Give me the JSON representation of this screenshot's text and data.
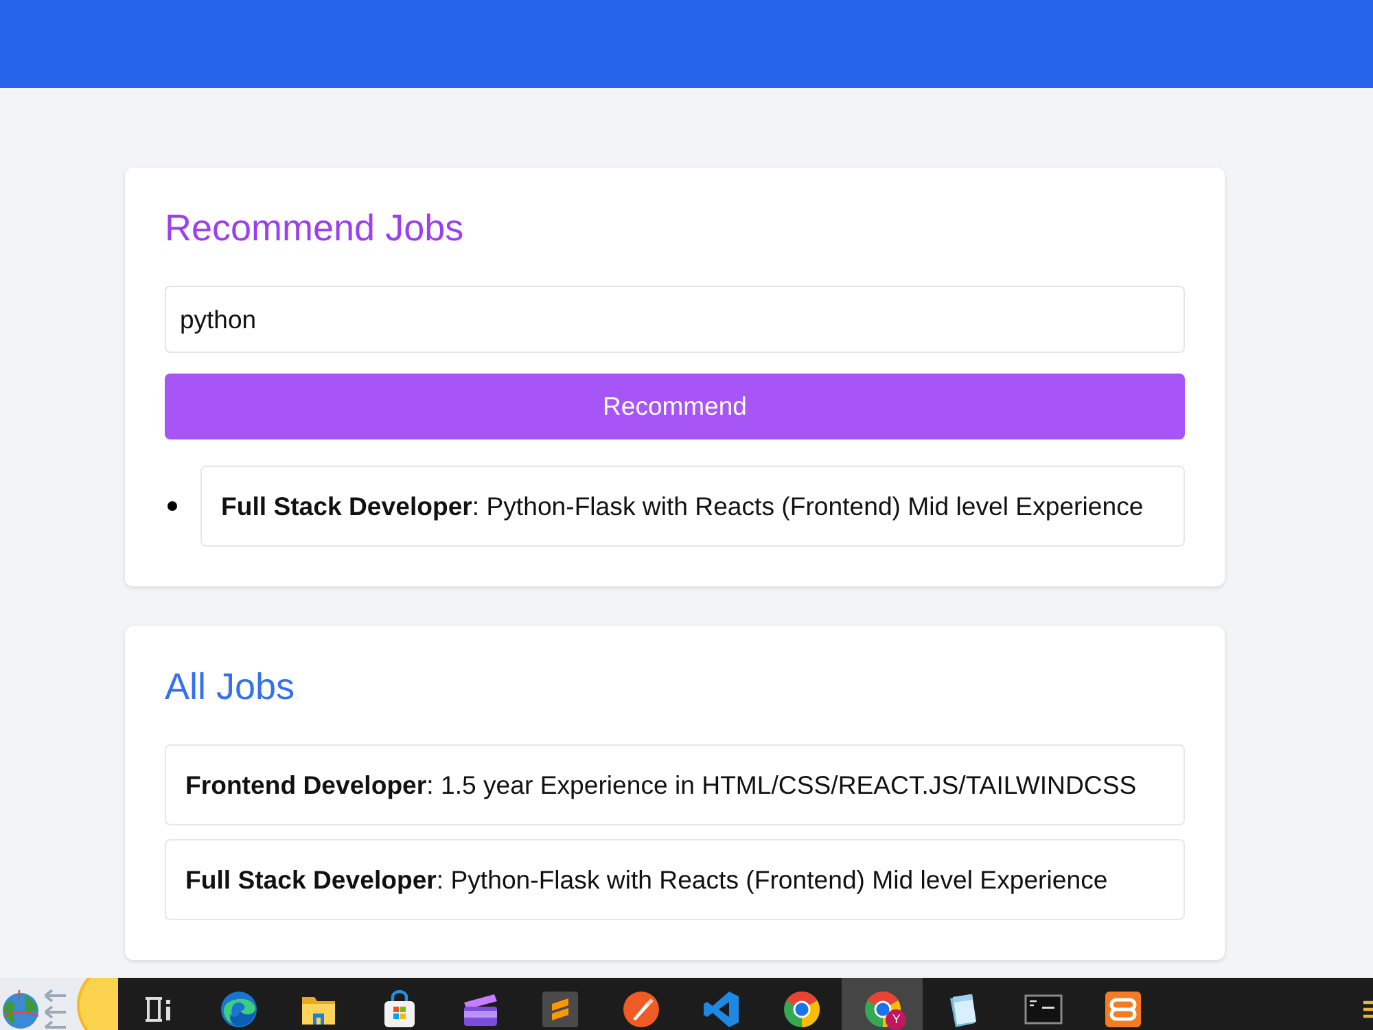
{
  "recommend": {
    "title": "Recommend Jobs",
    "query": "python",
    "button": "Recommend",
    "results": [
      {
        "text": "**Full Stack Developer**: Python-Flask with Reacts (Frontend) Mid level Experience"
      }
    ]
  },
  "all_jobs": {
    "title": "All Jobs",
    "jobs": [
      {
        "text": "**Frontend Developer**: 1.5 year Experience in HTML/CSS/REACT.JS/TAILWINDCSS"
      },
      {
        "text": "**Full Stack Developer**: Python-Flask with Reacts (Frontend) Mid level Experience"
      }
    ]
  },
  "taskbar": {
    "apps": [
      {
        "kind": "taskview",
        "active": false
      },
      {
        "kind": "swirl",
        "active": false
      },
      {
        "kind": "folder",
        "active": false
      },
      {
        "kind": "bag",
        "active": false
      },
      {
        "kind": "clapper",
        "active": false
      },
      {
        "kind": "slogo",
        "active": false
      },
      {
        "kind": "pen",
        "active": false
      },
      {
        "kind": "ribbon",
        "active": false
      },
      {
        "kind": "browser",
        "active": false
      },
      {
        "kind": "browser",
        "active": true,
        "badge": "Y"
      },
      {
        "kind": "notepad",
        "active": false
      },
      {
        "kind": "terminal",
        "active": false
      },
      {
        "kind": "knot",
        "active": false
      }
    ]
  }
}
